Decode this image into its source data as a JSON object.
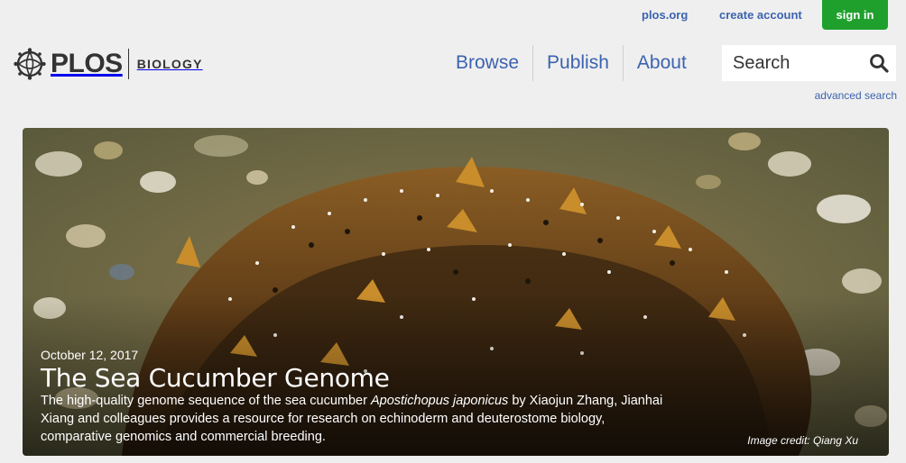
{
  "utility": {
    "plos_org": "plos.org",
    "create_account": "create account",
    "sign_in": "sign in"
  },
  "logo": {
    "word": "PLOS",
    "journal": "BIOLOGY"
  },
  "nav": {
    "items": [
      "Browse",
      "Publish",
      "About"
    ]
  },
  "search": {
    "placeholder": "Search",
    "advanced": "advanced search"
  },
  "hero": {
    "date": "October 12, 2017",
    "title": "The Sea Cucumber Genome",
    "desc_before": "The high-quality genome sequence of the sea cucumber ",
    "desc_species": "Apostichopus japonicus",
    "desc_after": " by Xiaojun Zhang, Jianhai Xiang and colleagues provides a resource for research on echinoderm and deuterostome biology, comparative genomics and commercial breeding.",
    "credit": "Image credit: Qiang Xu"
  },
  "colors": {
    "link": "#3c63af",
    "signin_bg": "#1fa02d",
    "page_bg": "#efefef"
  },
  "icons": [
    "plos-logo-icon",
    "search-icon"
  ]
}
